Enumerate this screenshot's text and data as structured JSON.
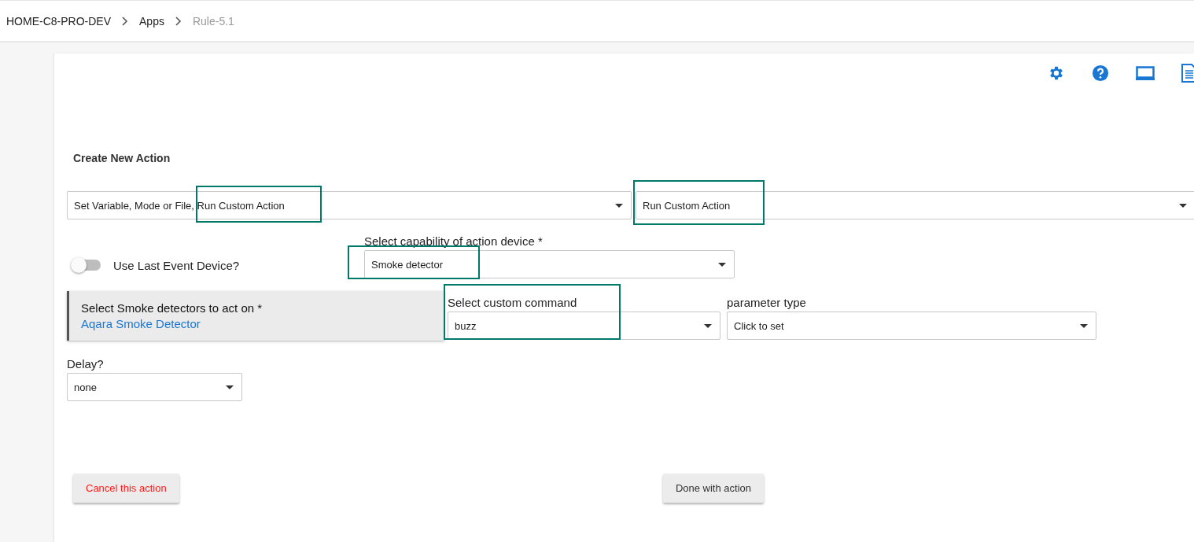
{
  "breadcrumb": [
    {
      "label": "HOME-C8-PRO-DEV",
      "current": false
    },
    {
      "label": "Apps",
      "current": false
    },
    {
      "label": "Rule-5.1",
      "current": true
    }
  ],
  "toolbar": [
    {
      "kind": "settings"
    },
    {
      "kind": "help"
    },
    {
      "kind": "screen"
    },
    {
      "kind": "document"
    }
  ],
  "heading": "Create New Action",
  "action_type": {
    "value": "Set Variable, Mode or File, Run Custom Action",
    "highlighted": true
  },
  "action": {
    "value": "Run Custom Action",
    "highlighted": true
  },
  "use_last_event_device": {
    "label": "Use Last Event Device?",
    "on": false
  },
  "capability": {
    "label": "Select capability of action device *",
    "value": "Smoke detector",
    "highlighted": true
  },
  "devices": {
    "label": "Select Smoke detectors to act on *",
    "link": "Aqara Smoke Detector"
  },
  "custom_command": {
    "label": "Select custom command",
    "value": "buzz",
    "highlighted": true
  },
  "parameter_type": {
    "label": "parameter type",
    "value": "Click to set"
  },
  "delay": {
    "label": "Delay?",
    "value": "none"
  },
  "buttons": [
    {
      "label": "Cancel this action",
      "kind": "danger"
    },
    {
      "label": "Done with action",
      "kind": "normal"
    }
  ]
}
